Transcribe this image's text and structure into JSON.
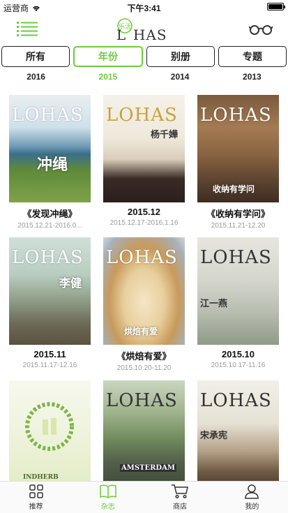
{
  "status": {
    "carrier": "运营商",
    "time": "下午3:41"
  },
  "header": {
    "logo_text": "LOHAS",
    "logo_mark": "乐活"
  },
  "segments": [
    {
      "label": "所有",
      "active": false
    },
    {
      "label": "年份",
      "active": true
    },
    {
      "label": "别册",
      "active": false
    },
    {
      "label": "专题",
      "active": false
    }
  ],
  "years": [
    {
      "label": "2016",
      "active": false
    },
    {
      "label": "2015",
      "active": true
    },
    {
      "label": "2014",
      "active": false
    },
    {
      "label": "2013",
      "active": false
    }
  ],
  "magazines": [
    {
      "title": "《发现冲绳》",
      "date": "2015.12.21-2016.0...",
      "cover_text": "冲绳"
    },
    {
      "title": "2015.12",
      "date": "2015.12.17-2016.1.16",
      "cover_text": "杨千嬅"
    },
    {
      "title": "《收纳有学问》",
      "date": "2015.11.21-12.20",
      "cover_text": "收纳有学问"
    },
    {
      "title": "2015.11",
      "date": "2015.11.17-12.16",
      "cover_text": "李健"
    },
    {
      "title": "《烘焙有爱》",
      "date": "2015.10.20-11.20",
      "cover_text": "烘焙有爱"
    },
    {
      "title": "2015.10",
      "date": "2015.10.17-11.16",
      "cover_text": "江一燕"
    },
    {
      "title": "",
      "date": "",
      "cover_text": "INDHERB"
    },
    {
      "title": "",
      "date": "",
      "cover_text": "AMSTERDAM"
    },
    {
      "title": "",
      "date": "",
      "cover_text": "宋承宪"
    }
  ],
  "tabs": [
    {
      "label": "推荐",
      "icon": "grid-icon",
      "active": false
    },
    {
      "label": "杂志",
      "icon": "book-icon",
      "active": true
    },
    {
      "label": "商店",
      "icon": "cart-icon",
      "active": false
    },
    {
      "label": "我的",
      "icon": "person-icon",
      "active": false
    }
  ],
  "colors": {
    "accent": "#6ecb3c"
  }
}
